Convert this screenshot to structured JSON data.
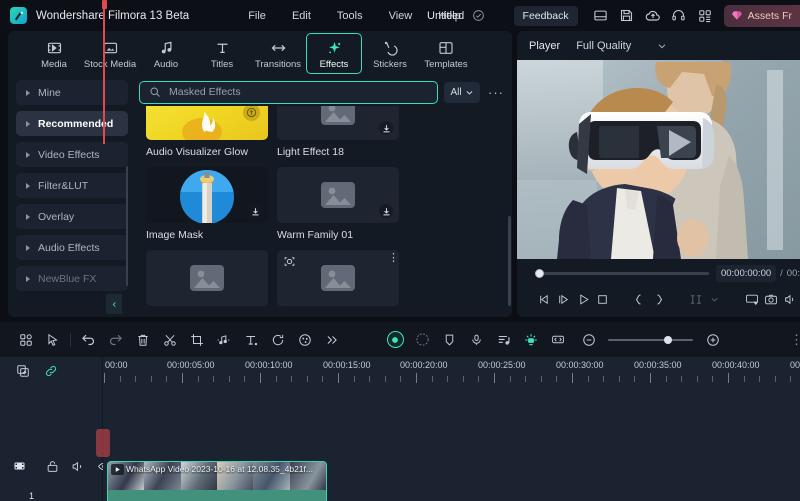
{
  "titlebar": {
    "app_title": "Wondershare Filmora 13 Beta",
    "menus": [
      "File",
      "Edit",
      "Tools",
      "View",
      "Help"
    ],
    "document_name": "Untitled",
    "feedback_label": "Feedback",
    "assets_label": "Assets Fr",
    "icons": [
      "import-icon",
      "save-icon",
      "cloud-upload-icon",
      "support-icon",
      "apps-grid-icon"
    ],
    "accent_green": "#32e0bb"
  },
  "tabs": [
    {
      "label": "Media",
      "icon": "media-icon",
      "active": false
    },
    {
      "label": "Stock Media",
      "icon": "stock-media-icon",
      "active": false
    },
    {
      "label": "Audio",
      "icon": "audio-note-icon",
      "active": false
    },
    {
      "label": "Titles",
      "icon": "titles-text-icon",
      "active": false
    },
    {
      "label": "Transitions",
      "icon": "transitions-arrow-icon",
      "active": false
    },
    {
      "label": "Effects",
      "icon": "effects-sparkle-icon",
      "active": true
    },
    {
      "label": "Stickers",
      "icon": "stickers-icon",
      "active": false
    },
    {
      "label": "Templates",
      "icon": "templates-grid-icon",
      "active": false
    }
  ],
  "categories": [
    {
      "label": "Mine",
      "state": "normal"
    },
    {
      "label": "Recommended",
      "state": "selected"
    },
    {
      "label": "Video Effects",
      "state": "normal"
    },
    {
      "label": "Filter&LUT",
      "state": "normal"
    },
    {
      "label": "Overlay",
      "state": "normal"
    },
    {
      "label": "Audio Effects",
      "state": "normal"
    },
    {
      "label": "NewBlue FX",
      "state": "dim"
    }
  ],
  "search": {
    "value": "Masked Effects",
    "placeholder": "Search",
    "filter_label": "All"
  },
  "effects": [
    {
      "name": "Audio Visualizer Glow",
      "thumb": "yellow-flame",
      "badge": "gold-coin",
      "download": false
    },
    {
      "name": "Light Effect 18",
      "thumb": "placeholder",
      "badge": "",
      "download": true
    },
    {
      "name": "Image Mask",
      "thumb": "lighthouse-circle",
      "badge": "",
      "download": true
    },
    {
      "name": "Warm Family 01",
      "thumb": "placeholder",
      "badge": "",
      "download": true
    },
    {
      "name": "",
      "thumb": "placeholder",
      "badge": "",
      "download": false
    },
    {
      "name": "",
      "thumb": "placeholder",
      "badge": "ar-icon",
      "download": false
    }
  ],
  "player": {
    "label": "Player",
    "quality": "Full Quality",
    "current_time": "00:00:00:00",
    "separator": "/",
    "total_time": "00:",
    "controls": [
      "prev-frame-icon",
      "next-frame-icon",
      "play-icon",
      "stop-icon",
      "mark-in-icon",
      "mark-out-icon",
      "aspect-ratio-icon",
      "quality-chevron-icon",
      "fullscreen-icon",
      "snapshot-icon",
      "volume-icon"
    ]
  },
  "timeline_toolbar": {
    "left_icons": [
      "grid-select-icon",
      "cursor-tool-icon",
      "undo-icon",
      "redo-icon",
      "delete-icon",
      "split-scissors-icon",
      "crop-icon",
      "audio-detach-icon",
      "text-tool-icon",
      "rotate-icon",
      "color-palette-icon",
      "more-chevrons-icon"
    ],
    "right_icons": [
      "record-voice-icon",
      "render-preview-icon",
      "marker-icon",
      "mic-icon",
      "audio-mixer-icon",
      "keyframe-icon",
      "fit-timeline-icon",
      "zoom-out-icon",
      "zoom-in-icon",
      "more-vertical-icon"
    ]
  },
  "timeline": {
    "ruler_labels": [
      "00:00",
      "00:00:05:00",
      "00:00:10:00",
      "00:00:15:00",
      "00:00:20:00",
      "00:00:25:00",
      "00:00:30:00",
      "00:00:35:00",
      "00:00:40:00",
      "00:"
    ],
    "track_header_icons": [
      "add-track-icon",
      "link-icon"
    ],
    "track1": {
      "number": "1",
      "icons": [
        "video-track-icon",
        "lock-icon",
        "mute-icon",
        "eye-icon"
      ]
    },
    "clip": {
      "label": "WhatsApp Video 2023-10-16 at 12.08.35_4b21f...",
      "color": "#2f7f6d",
      "border_color": "#3ad6b3"
    },
    "playhead_color": "#e04a4f"
  }
}
